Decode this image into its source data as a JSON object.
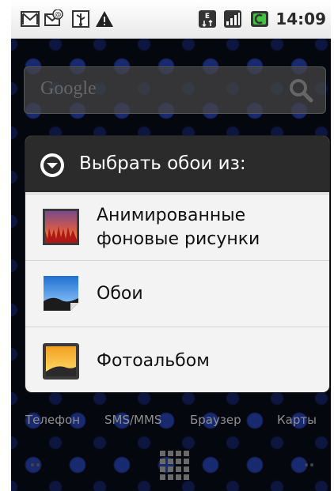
{
  "statusbar": {
    "time": "14:09",
    "icons": [
      "gmail-icon",
      "email-icon",
      "usb-icon",
      "warning-icon",
      "data-transfer-icon",
      "signal-bars-icon",
      "battery-charging-icon"
    ]
  },
  "search": {
    "placeholder": "Google",
    "icon": "search-icon"
  },
  "dialog": {
    "title": "Выбрать обои из:",
    "title_icon": "dropdown-circle-icon",
    "items": [
      {
        "line1": "Анимированные",
        "line2": "фоновые рисунки",
        "icon": "live-wallpaper-icon"
      },
      {
        "label": "Обои",
        "icon": "wallpapers-icon"
      },
      {
        "label": "Фотоальбом",
        "icon": "gallery-icon"
      }
    ]
  },
  "dock": {
    "items": [
      "Телефон",
      "SMS/MMS",
      "Браузер",
      "Карты"
    ]
  },
  "bottom": {
    "icons": [
      "page-dots-left-icon",
      "app-drawer-grid-icon",
      "page-dots-right-icon"
    ]
  }
}
